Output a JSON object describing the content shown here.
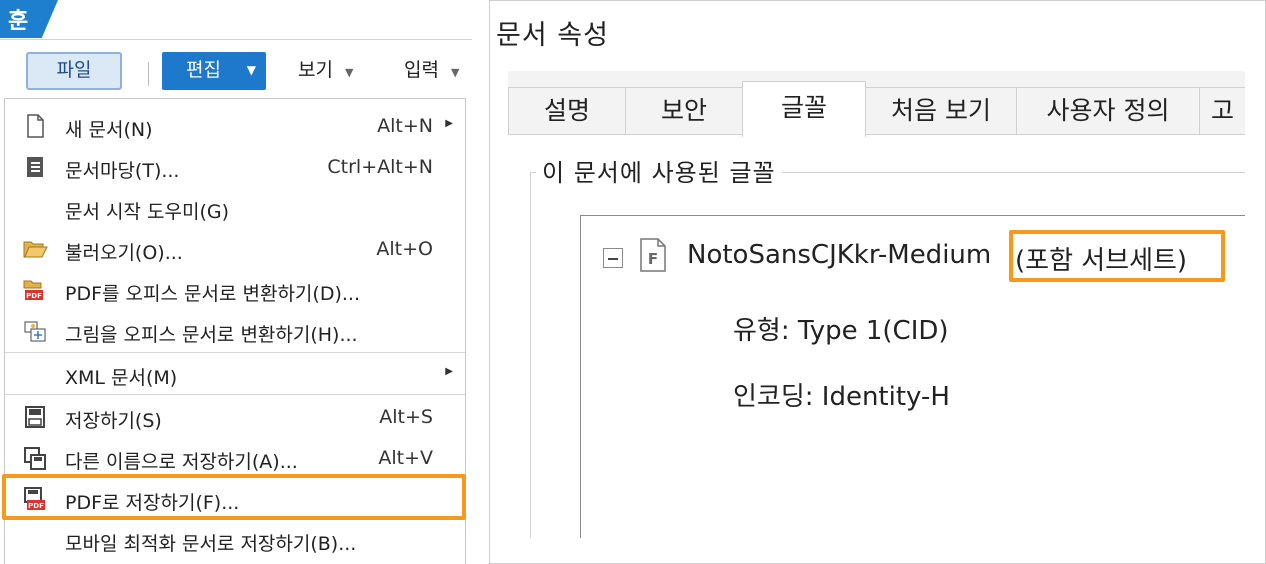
{
  "app": {
    "badge": "훈"
  },
  "ribbon": {
    "file_label": "파일",
    "edit_label": "편집",
    "view_label": "보기",
    "insert_label": "입력"
  },
  "menu": {
    "items": [
      {
        "label": "새 문서(N)",
        "shortcut": "Alt+N",
        "icon": "new-document-icon",
        "submenu": true
      },
      {
        "label": "문서마당(T)...",
        "shortcut": "Ctrl+Alt+N",
        "icon": "template-icon",
        "submenu": false
      },
      {
        "label": "문서 시작 도우미(G)",
        "shortcut": "",
        "icon": "",
        "submenu": false
      },
      {
        "label": "불러오기(O)...",
        "shortcut": "Alt+O",
        "icon": "folder-open-icon",
        "submenu": false
      },
      {
        "label": "PDF를 오피스 문서로 변환하기(D)...",
        "shortcut": "",
        "icon": "pdf-convert-icon",
        "submenu": false
      },
      {
        "label": "그림을 오피스 문서로 변환하기(H)...",
        "shortcut": "",
        "icon": "image-convert-icon",
        "submenu": false
      },
      {
        "label": "XML 문서(M)",
        "shortcut": "",
        "icon": "",
        "submenu": true
      },
      {
        "label": "저장하기(S)",
        "shortcut": "Alt+S",
        "icon": "save-icon",
        "submenu": false
      },
      {
        "label": "다른 이름으로 저장하기(A)...",
        "shortcut": "Alt+V",
        "icon": "save-as-icon",
        "submenu": false
      },
      {
        "label": "PDF로 저장하기(F)...",
        "shortcut": "",
        "icon": "save-pdf-icon",
        "submenu": false
      },
      {
        "label": "모바일 최적화 문서로 저장하기(B)...",
        "shortcut": "",
        "icon": "",
        "submenu": false
      }
    ]
  },
  "dialog": {
    "title": "문서 속성",
    "tabs": [
      {
        "label": "설명",
        "active": false
      },
      {
        "label": "보안",
        "active": false
      },
      {
        "label": "글꼴",
        "active": true
      },
      {
        "label": "처음 보기",
        "active": false
      },
      {
        "label": "사용자 정의",
        "active": false
      },
      {
        "label": "고",
        "active": false
      }
    ],
    "group_label": "이 문서에 사용된 글꼴",
    "font": {
      "name": "NotoSansCJKkr-Medium",
      "embed": "(포함 서브세트)",
      "type": "유형: Type 1(CID)",
      "encoding": "인코딩: Identity-H"
    }
  },
  "colors": {
    "highlight": "#f59a1f",
    "accent": "#1e78cc",
    "pdf_red": "#d9332b"
  }
}
